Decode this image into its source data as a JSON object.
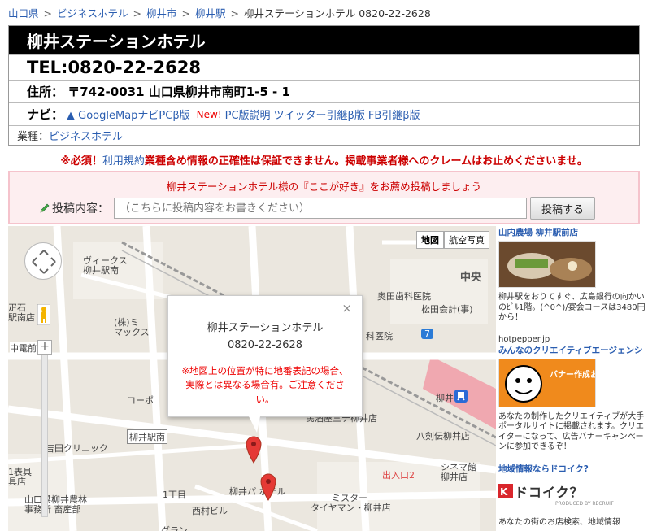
{
  "breadcrumb": {
    "items": [
      "山口県",
      "ビジネスホテル",
      "柳井市",
      "柳井駅"
    ],
    "current": "柳井ステーションホテル 0820-22-2628",
    "separator": ">"
  },
  "info": {
    "name": "柳井ステーションホテル",
    "tel": "TEL:0820-22-2628",
    "address": "住所： 〒742-0031 山口県柳井市南町1-5 - 1",
    "navi_label": "ナビ：",
    "navi_links": [
      "▲ GoogleMapナビPCβ版"
    ],
    "navi_new": "New!",
    "navi_links2": [
      "PC版説明",
      "ツイッター引継β版",
      "FB引継β版"
    ],
    "category_label": "業種：",
    "category_value": "ビジネスホテル"
  },
  "warning": {
    "prefix": "※必須！",
    "terms_link": "利用規約",
    "text": "業種含め情報の正確性は保証できません。掲載事業者様へのクレームはお止めくださいませ。"
  },
  "post": {
    "title": "柳井ステーションホテル様の『ここが好き』をお薦め投稿しましょう",
    "label": "投稿内容：",
    "placeholder": "（こちらに投稿内容をお書きください）",
    "submit": "投稿する"
  },
  "map": {
    "type_buttons": [
      "地図",
      "航空写真"
    ],
    "zoom_in": "+",
    "zoom_out": "−",
    "infowindow": {
      "name": "柳井ステーションホテル",
      "tel": "0820-22-2628",
      "note": "※地図上の位置が特に地番表記の場合、実際とは異なる場合有。ご注意ください。",
      "close": "×"
    },
    "labels": {
      "vicus": "ヴィークス",
      "vicus2": "柳井駅南",
      "chuo": "中央",
      "okuda": "奥田歯科医院",
      "matsuda": "松田会計(事)",
      "clinic": "女丶科医院",
      "mitsui": "(株)ミ",
      "mitsui2": "マックス",
      "nanseki": "疋石",
      "nanseki2": "駅南店",
      "chuden": "中電前",
      "kobo": "コーポ",
      "yanaieki": "柳井駅南",
      "yoshida": "吉田クリニック",
      "yanai": "柳井",
      "minnan": "民酒屋三チ柳井店",
      "yatsurugi": "八剣伝柳井店",
      "shinema": "シネマ館",
      "shinema2": "柳井店",
      "exit": "出入口2",
      "ichome": "1丁目",
      "pin_label": "柳井パ   ホテル",
      "nishida": "西村ビル",
      "mister": "ミスター",
      "mister2": "タイヤマン・柳井店",
      "jakuhyo": "1表具",
      "jakuhyo2": "具店",
      "yamaguchi": "山口県柳井農林",
      "yamaguchi2": "事務所 畜産部",
      "route": "7",
      "guran": "グラン"
    }
  },
  "sidebar": {
    "ad1_headline": "山内農場 柳井駅前店",
    "ad1_desc": "柳井駅をおりてすぐ、広島銀行の向かいのﾋﾞﾙ1階。(^0^)/宴会コースは3480円から！",
    "ad2_source": "hotpepper.jp",
    "ad2_headline": "みんなのクリエイティブエージェンシ",
    "ad2_img_text": "バナー作成お任せ",
    "ad2_desc": "あなたの制作したクリエイティブが大手ポータルサイトに掲載されます。クリエイターになって、広告バナーキャンペーンに参加できるぞ！",
    "ad3_headline": "地域情報ならドコイク?",
    "ad3_logo": "ドコイク？",
    "ad3_logo_sub": "PRODUCED BY RECRUIT",
    "ad3_desc": "あなたの街のお店検索、地域情報"
  },
  "colors": {
    "accent_red": "#cc0000",
    "link_blue": "#2a5db0",
    "header_black": "#000000",
    "pink_bg": "#fdeef0"
  }
}
